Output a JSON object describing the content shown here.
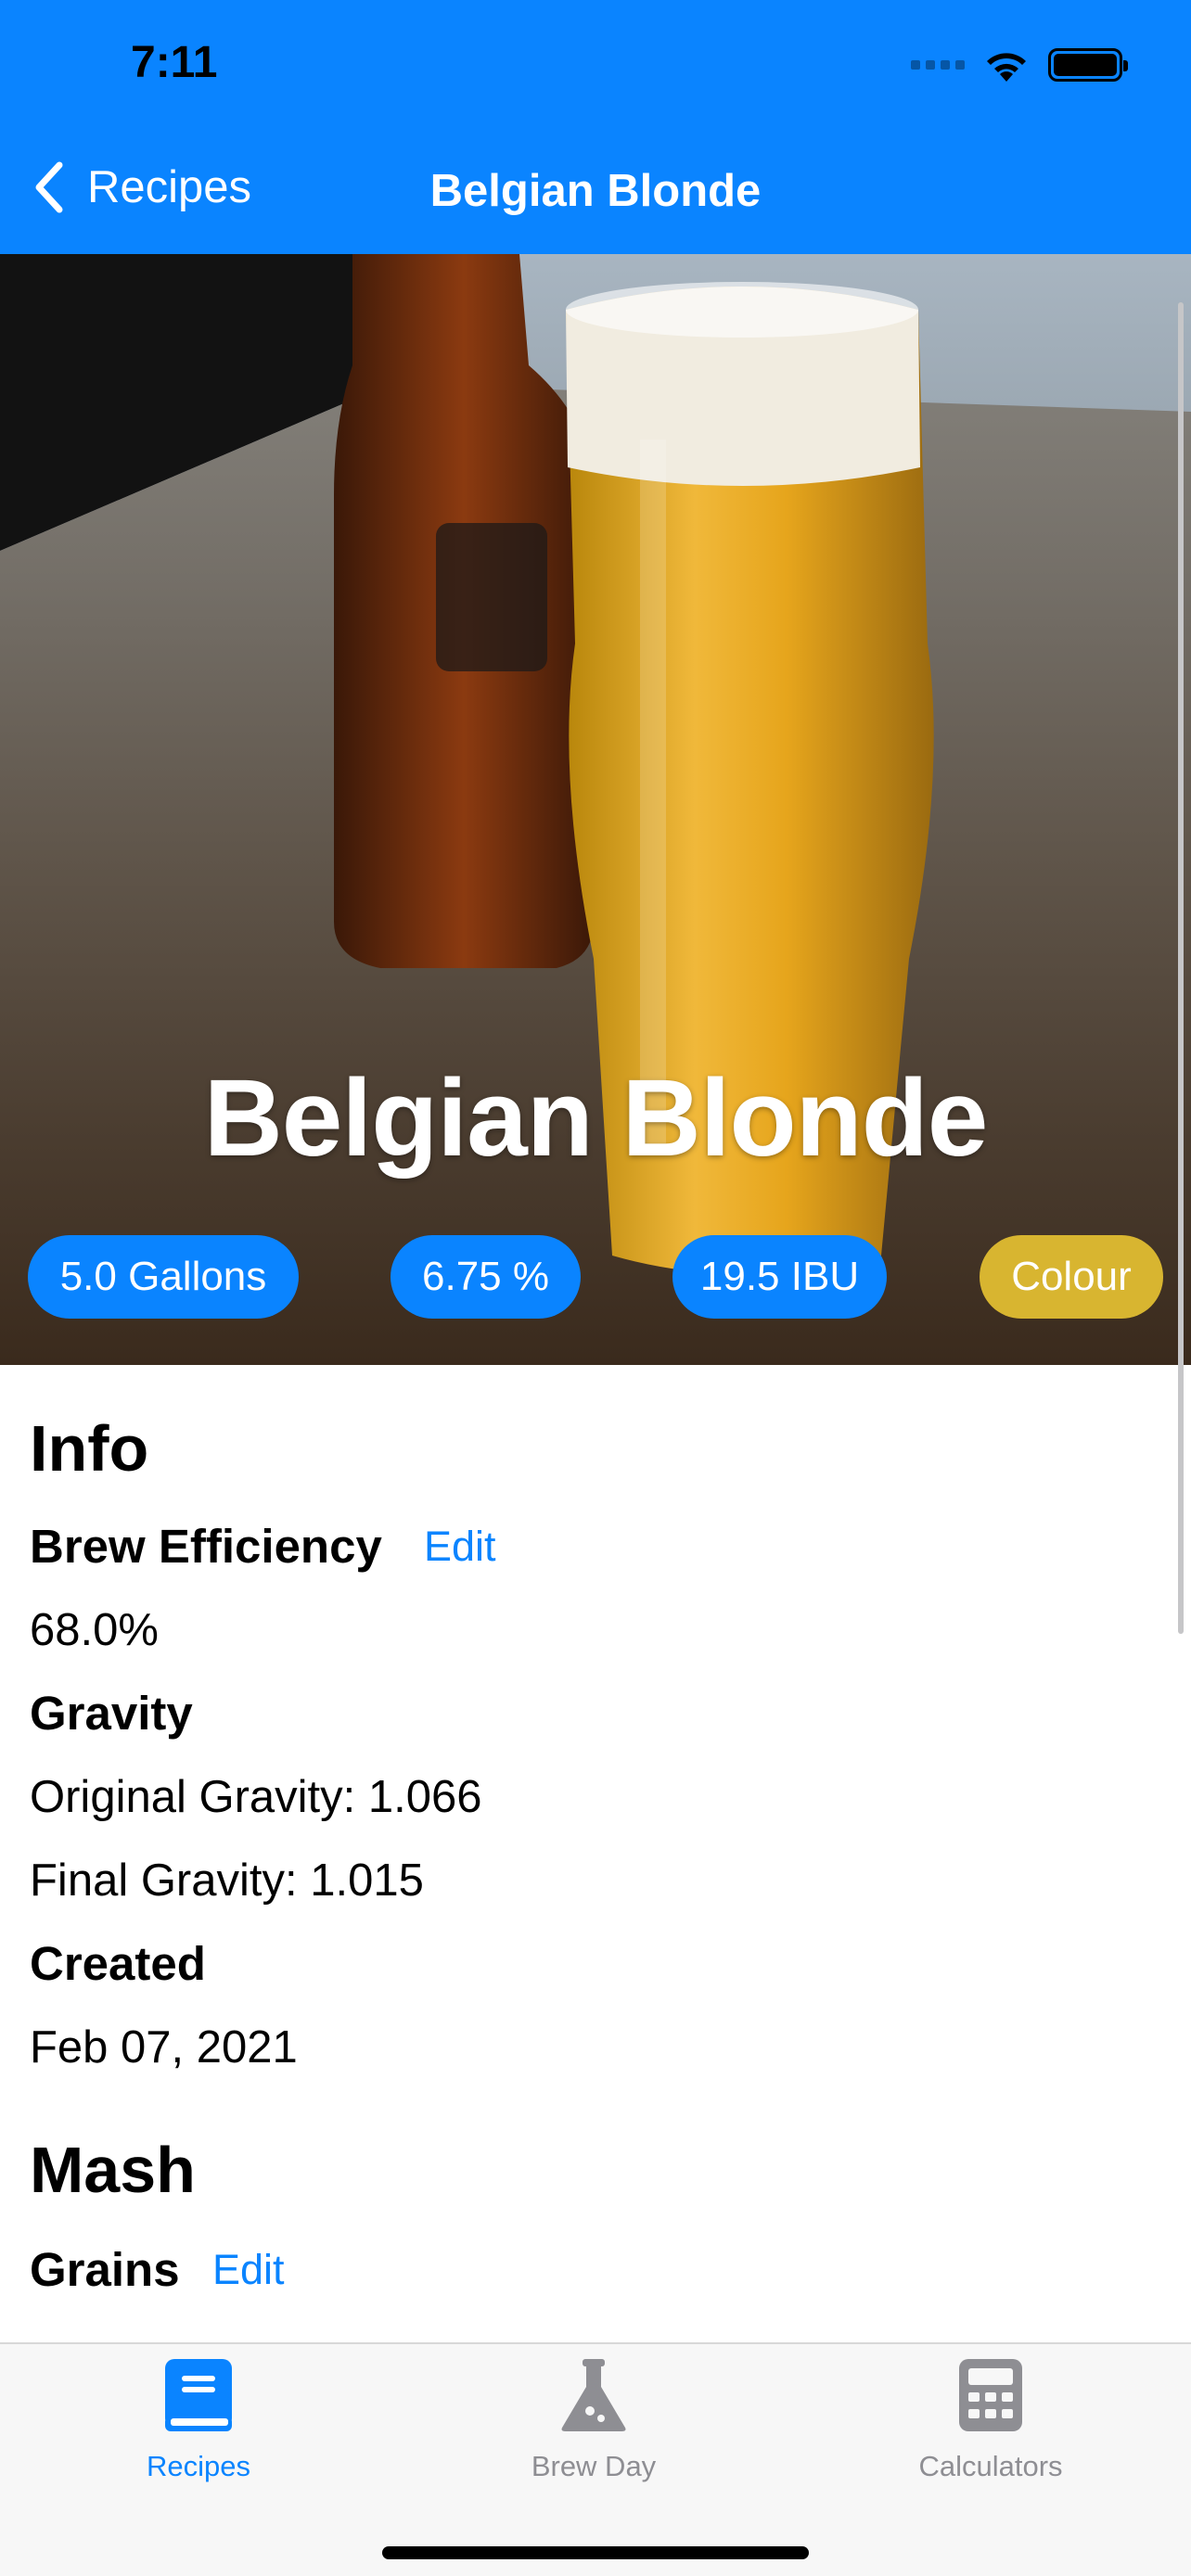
{
  "status_bar": {
    "time": "7:11"
  },
  "nav": {
    "back_label": "Recipes",
    "title": "Belgian Blonde"
  },
  "hero": {
    "title": "Belgian Blonde",
    "badges": [
      {
        "label": "5.0 Gallons",
        "color": "#0a84ff"
      },
      {
        "label": "6.75 %",
        "color": "#0a84ff"
      },
      {
        "label": "19.5 IBU",
        "color": "#0a84ff"
      },
      {
        "label": "Colour",
        "color": "#d8b530"
      }
    ]
  },
  "info": {
    "heading": "Info",
    "efficiency_label": "Brew Efficiency",
    "efficiency_edit": "Edit",
    "efficiency_value": "68.0%",
    "gravity_label": "Gravity",
    "original_gravity": "Original Gravity: 1.066",
    "final_gravity": "Final Gravity: 1.015",
    "created_label": "Created",
    "created_value": "Feb 07, 2021"
  },
  "mash": {
    "heading": "Mash",
    "grains_label": "Grains",
    "grains_edit": "Edit"
  },
  "tabbar": {
    "tabs": [
      {
        "label": "Recipes",
        "icon": "book-icon",
        "active": true
      },
      {
        "label": "Brew Day",
        "icon": "flask-icon",
        "active": false
      },
      {
        "label": "Calculators",
        "icon": "calculator-icon",
        "active": false
      }
    ]
  },
  "colors": {
    "accent": "#0a84ff",
    "colour_badge": "#d8b530",
    "inactive_tab": "#8e8e93"
  }
}
